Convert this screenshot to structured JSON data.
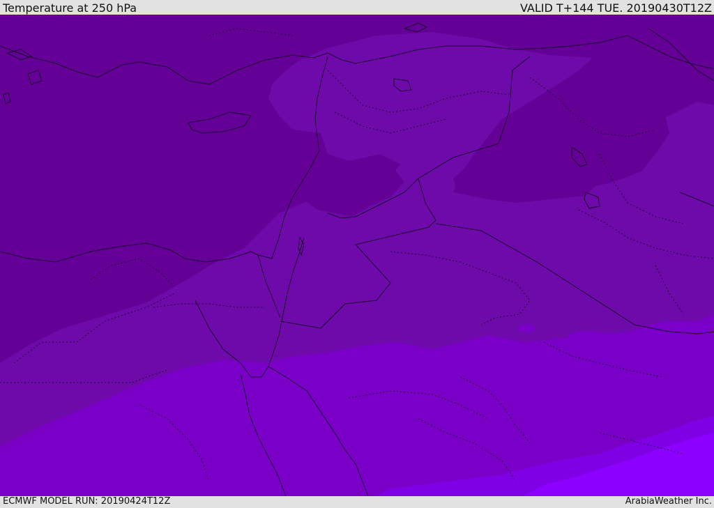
{
  "header": {
    "title": "Temperature at 250 hPa",
    "valid_time": "VALID T+144 TUE. 20190430T12Z"
  },
  "footer": {
    "model_run": "ECMWF MODEL RUN: 20190424T12Z",
    "credit": "ArabiaWeather Inc."
  },
  "map": {
    "field": "Temperature at 250 hPa",
    "colors": {
      "darkest_purple": "#640096",
      "dark_purple": "#6f0aaa",
      "medium_purple": "#7a00c8",
      "bright_purple": "#8000e6",
      "brightest_purple": "#8c00ff",
      "border_line": "#1a0030"
    }
  }
}
